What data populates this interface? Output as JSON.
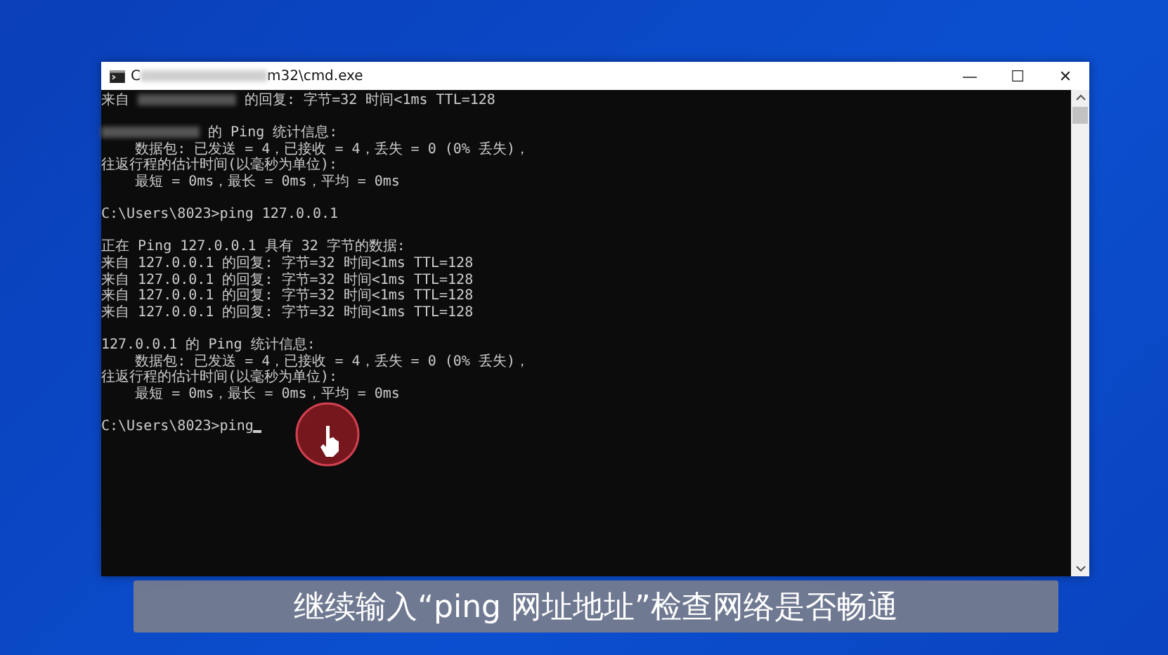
{
  "window": {
    "title_start": "C",
    "title_end": "m32\\cmd.exe",
    "title_redacted": true,
    "minimize": "—",
    "maximize": "☐",
    "close": "✕"
  },
  "console": {
    "lines": [
      {
        "kind": "text",
        "segments": [
          {
            "kind": "text",
            "text": "来自 "
          },
          {
            "kind": "redacted"
          },
          {
            "kind": "text",
            "text": " 的回复: 字节=32 时间<1ms TTL=128"
          }
        ]
      },
      {
        "kind": "blank"
      },
      {
        "kind": "text",
        "segments": [
          {
            "kind": "redacted"
          },
          {
            "kind": "text",
            "text": " 的 Ping 统计信息:"
          }
        ]
      },
      {
        "kind": "text",
        "segments": [
          {
            "kind": "text",
            "text": "    数据包: 已发送 = 4，已接收 = 4，丢失 = 0 (0% 丢失)，"
          }
        ]
      },
      {
        "kind": "text",
        "segments": [
          {
            "kind": "text",
            "text": "往返行程的估计时间(以毫秒为单位):"
          }
        ]
      },
      {
        "kind": "text",
        "segments": [
          {
            "kind": "text",
            "text": "    最短 = 0ms，最长 = 0ms，平均 = 0ms"
          }
        ]
      },
      {
        "kind": "blank"
      },
      {
        "kind": "text",
        "segments": [
          {
            "kind": "text",
            "text": "C:\\Users\\8023>ping 127.0.0.1"
          }
        ]
      },
      {
        "kind": "blank"
      },
      {
        "kind": "text",
        "segments": [
          {
            "kind": "text",
            "text": "正在 Ping 127.0.0.1 具有 32 字节的数据:"
          }
        ]
      },
      {
        "kind": "text",
        "segments": [
          {
            "kind": "text",
            "text": "来自 127.0.0.1 的回复: 字节=32 时间<1ms TTL=128"
          }
        ]
      },
      {
        "kind": "text",
        "segments": [
          {
            "kind": "text",
            "text": "来自 127.0.0.1 的回复: 字节=32 时间<1ms TTL=128"
          }
        ]
      },
      {
        "kind": "text",
        "segments": [
          {
            "kind": "text",
            "text": "来自 127.0.0.1 的回复: 字节=32 时间<1ms TTL=128"
          }
        ]
      },
      {
        "kind": "text",
        "segments": [
          {
            "kind": "text",
            "text": "来自 127.0.0.1 的回复: 字节=32 时间<1ms TTL=128"
          }
        ]
      },
      {
        "kind": "blank"
      },
      {
        "kind": "text",
        "segments": [
          {
            "kind": "text",
            "text": "127.0.0.1 的 Ping 统计信息:"
          }
        ]
      },
      {
        "kind": "text",
        "segments": [
          {
            "kind": "text",
            "text": "    数据包: 已发送 = 4，已接收 = 4，丢失 = 0 (0% 丢失)，"
          }
        ]
      },
      {
        "kind": "text",
        "segments": [
          {
            "kind": "text",
            "text": "往返行程的估计时间(以毫秒为单位):"
          }
        ]
      },
      {
        "kind": "text",
        "segments": [
          {
            "kind": "text",
            "text": "    最短 = 0ms，最长 = 0ms，平均 = 0ms"
          }
        ]
      },
      {
        "kind": "blank"
      },
      {
        "kind": "text",
        "segments": [
          {
            "kind": "text",
            "text": "C:\\Users\\8023>ping"
          }
        ],
        "cursor": true
      }
    ]
  },
  "click_indicator": true,
  "subtitle": "继续输入“ping 网址地址”检查网络是否畅通"
}
